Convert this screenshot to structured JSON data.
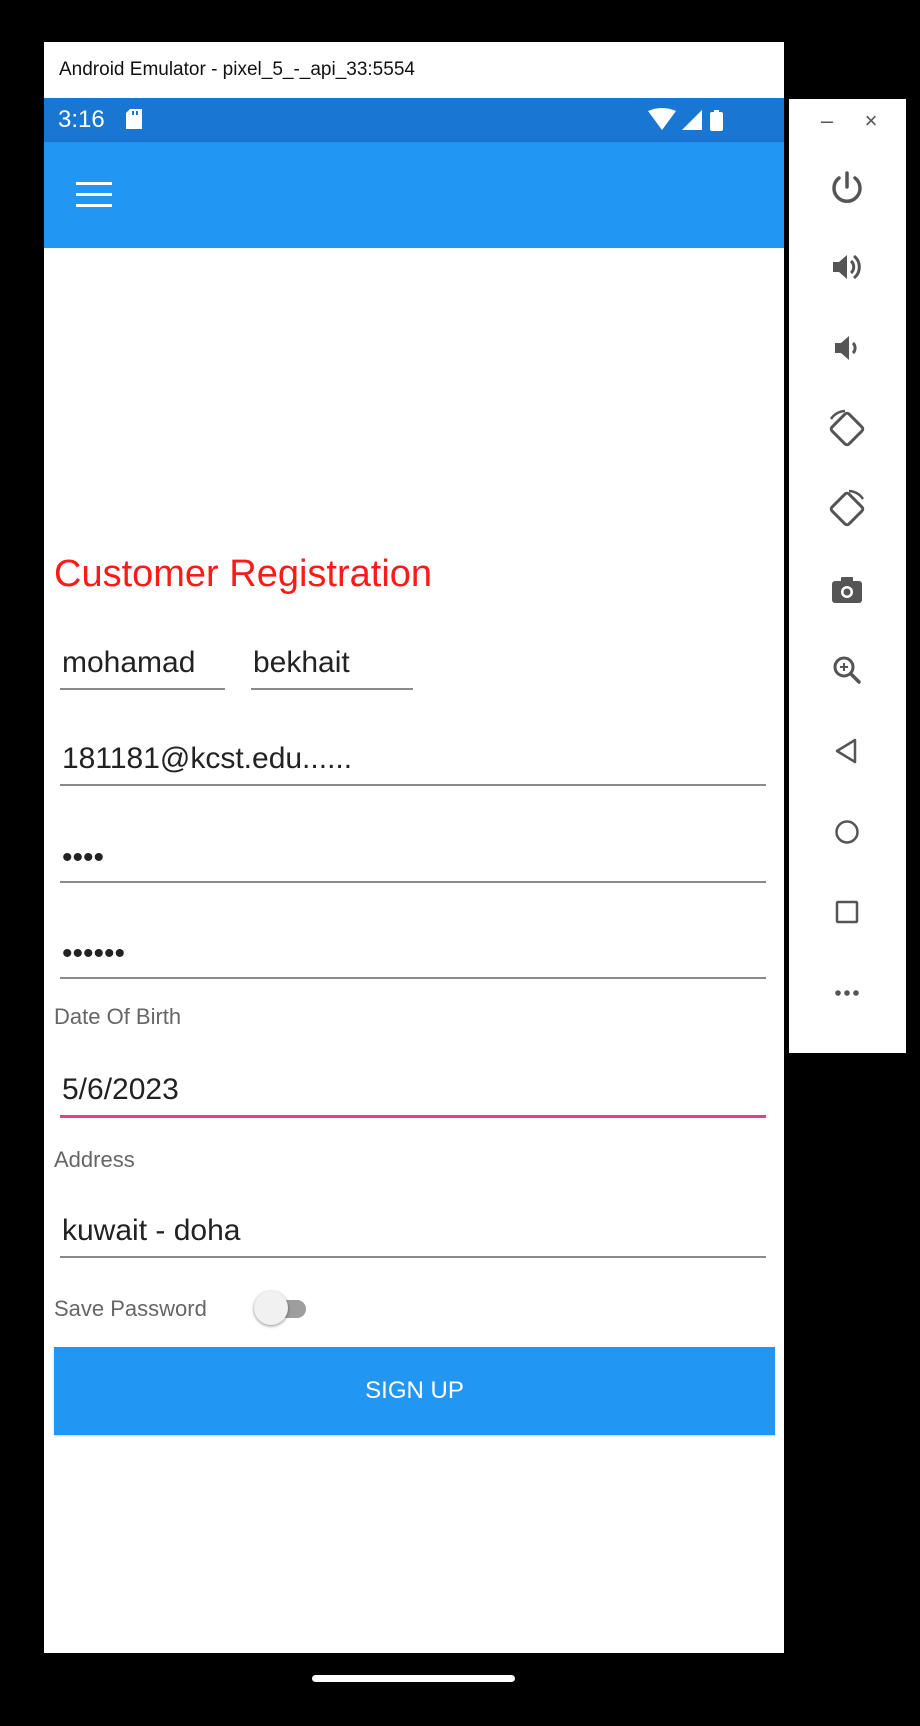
{
  "window": {
    "title": "Android Emulator - pixel_5_-_api_33:5554"
  },
  "status_bar": {
    "time": "3:16",
    "icons": [
      "sd-card-icon",
      "wifi-icon",
      "signal-icon",
      "battery-icon"
    ]
  },
  "toolbar": {
    "menu_icon": "hamburger-menu-icon",
    "color": "#2196F3"
  },
  "form": {
    "title": "Customer Registration",
    "first_name": "mohamad",
    "last_name": "bekhait",
    "email": "181181@kcst.edu......",
    "password_mask": "••••",
    "confirm_password_mask": "••••••",
    "dob_label": "Date Of Birth",
    "dob_value": "5/6/2023",
    "address_label": "Address",
    "address_value": "kuwait - doha",
    "save_password_label": "Save Password",
    "save_password_on": false,
    "signup_label": "SIGN UP"
  },
  "side_panel": {
    "minimize": "–",
    "close": "×",
    "buttons": [
      "power-icon",
      "volume-up-icon",
      "volume-down-icon",
      "rotate-left-icon",
      "rotate-right-icon",
      "camera-icon",
      "zoom-icon",
      "back-icon",
      "home-icon",
      "overview-icon",
      "more-icon"
    ]
  },
  "colors": {
    "status_bar": "#1976D2",
    "title": "#ff1a1a",
    "focus_underline": "#e9407a",
    "button": "#2196F3"
  }
}
